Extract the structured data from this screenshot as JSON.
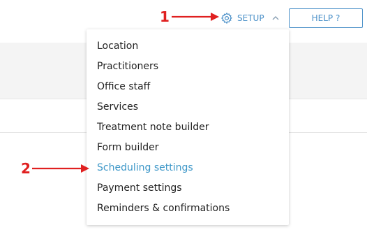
{
  "header": {
    "setup_label": "SETUP",
    "help_label": "HELP ?"
  },
  "setup_menu": {
    "items": [
      {
        "label": "Location"
      },
      {
        "label": "Practitioners"
      },
      {
        "label": "Office staff"
      },
      {
        "label": "Services"
      },
      {
        "label": "Treatment note builder"
      },
      {
        "label": "Form builder"
      },
      {
        "label": "Scheduling settings",
        "highlighted": true
      },
      {
        "label": "Payment settings"
      },
      {
        "label": "Reminders & confirmations"
      }
    ]
  },
  "annotations": {
    "step1": "1",
    "step2": "2"
  },
  "colors": {
    "accent": "#4a90c8",
    "highlight": "#3d97c8",
    "annotation": "#e02020"
  },
  "icons": [
    "gear-icon",
    "chevron-up-icon",
    "arrow-right-icon"
  ]
}
